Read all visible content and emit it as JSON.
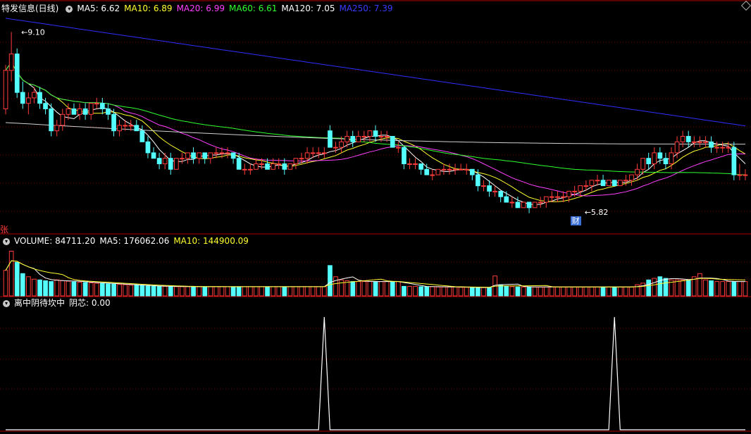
{
  "stock_title": "特发信息(日线)",
  "colors": {
    "up": "#ff3b3b",
    "down": "#54ffff",
    "ma5": "#ffffff",
    "ma10": "#ffff2e",
    "ma20": "#ff40ff",
    "ma60": "#2eff2e",
    "ma120": "#d0d0d0",
    "ma250": "#2e2eff",
    "grid": "#7a0000",
    "divider": "#b00000",
    "signal": "#ffffff"
  },
  "price_legend": [
    {
      "label": "MA5: 6.62",
      "color": "#ffffff"
    },
    {
      "label": "MA10: 6.89",
      "color": "#ffff2e"
    },
    {
      "label": "MA20: 6.99",
      "color": "#ff40ff"
    },
    {
      "label": "MA60: 6.61",
      "color": "#2eff2e"
    },
    {
      "label": "MA120: 7.05",
      "color": "#ffffff"
    },
    {
      "label": "MA250: 7.39",
      "color": "#3a3aff"
    }
  ],
  "volume_legend": [
    {
      "label": "VOLUME: 84711.20",
      "color": "#ffffff"
    },
    {
      "label": "MA5: 176062.06",
      "color": "#ffffff"
    },
    {
      "label": "MA10: 144900.09",
      "color": "#ffff2e"
    }
  ],
  "indicator_legend": [
    {
      "label": "离中阴待坎中",
      "color": "#ffffff"
    },
    {
      "label": "阴芯: 0.00",
      "color": "#ffffff"
    }
  ],
  "side_label": "张",
  "cai_label": "财",
  "chart_data": [
    {
      "type": "candlestick",
      "title": "特发信息(日线)",
      "ylim": [
        5.5,
        9.4
      ],
      "annotations": [
        {
          "text": "9.10",
          "x": 1,
          "value": 9.1
        },
        {
          "text": "5.82",
          "x": 100,
          "value": 5.82
        }
      ],
      "candles": [
        [
          7.7,
          8.5,
          7.6,
          8.4
        ],
        [
          8.4,
          9.1,
          8.2,
          8.7
        ],
        [
          8.7,
          8.8,
          7.9,
          8.0
        ],
        [
          8.0,
          8.2,
          7.7,
          7.8
        ],
        [
          7.8,
          8.0,
          7.6,
          7.9
        ],
        [
          7.9,
          8.1,
          7.8,
          8.0
        ],
        [
          8.0,
          8.1,
          7.7,
          7.8
        ],
        [
          7.8,
          7.9,
          7.6,
          7.7
        ],
        [
          7.7,
          7.8,
          7.2,
          7.3
        ],
        [
          7.3,
          7.5,
          7.2,
          7.4
        ],
        [
          7.4,
          7.7,
          7.3,
          7.6
        ],
        [
          7.6,
          7.8,
          7.5,
          7.7
        ],
        [
          7.7,
          7.8,
          7.6,
          7.6
        ],
        [
          7.6,
          7.8,
          7.5,
          7.7
        ],
        [
          7.7,
          7.8,
          7.5,
          7.6
        ],
        [
          7.6,
          7.8,
          7.5,
          7.8
        ],
        [
          7.8,
          7.9,
          7.7,
          7.8
        ],
        [
          7.8,
          7.9,
          7.6,
          7.7
        ],
        [
          7.7,
          7.8,
          7.5,
          7.6
        ],
        [
          7.6,
          7.7,
          7.2,
          7.3
        ],
        [
          7.3,
          7.5,
          7.2,
          7.4
        ],
        [
          7.4,
          7.5,
          7.3,
          7.4
        ],
        [
          7.4,
          7.5,
          7.3,
          7.4
        ],
        [
          7.4,
          7.5,
          7.3,
          7.3
        ],
        [
          7.3,
          7.4,
          7.1,
          7.1
        ],
        [
          7.1,
          7.2,
          6.8,
          6.9
        ],
        [
          6.9,
          7.0,
          6.8,
          6.8
        ],
        [
          6.8,
          6.9,
          6.6,
          6.7
        ],
        [
          6.7,
          6.9,
          6.6,
          6.8
        ],
        [
          6.8,
          6.9,
          6.5,
          6.6
        ],
        [
          6.6,
          6.8,
          6.6,
          6.8
        ],
        [
          6.8,
          6.9,
          6.7,
          6.8
        ],
        [
          6.8,
          6.9,
          6.7,
          6.9
        ],
        [
          6.9,
          7.0,
          6.7,
          6.8
        ],
        [
          6.8,
          6.9,
          6.7,
          6.9
        ],
        [
          6.9,
          6.9,
          6.7,
          6.8
        ],
        [
          6.8,
          6.9,
          6.7,
          6.9
        ],
        [
          6.9,
          7.0,
          6.8,
          6.9
        ],
        [
          6.9,
          7.0,
          6.8,
          6.9
        ],
        [
          6.9,
          7.0,
          6.8,
          6.9
        ],
        [
          6.9,
          6.9,
          6.7,
          6.8
        ],
        [
          6.8,
          6.9,
          6.6,
          6.6
        ],
        [
          6.6,
          6.7,
          6.5,
          6.6
        ],
        [
          6.6,
          6.7,
          6.5,
          6.6
        ],
        [
          6.6,
          6.8,
          6.6,
          6.7
        ],
        [
          6.7,
          6.8,
          6.6,
          6.7
        ],
        [
          6.7,
          6.8,
          6.6,
          6.6
        ],
        [
          6.6,
          6.8,
          6.6,
          6.7
        ],
        [
          6.7,
          6.8,
          6.6,
          6.7
        ],
        [
          6.7,
          6.8,
          6.5,
          6.6
        ],
        [
          6.6,
          6.7,
          6.6,
          6.7
        ],
        [
          6.7,
          6.8,
          6.6,
          6.8
        ],
        [
          6.8,
          6.9,
          6.7,
          6.8
        ],
        [
          6.8,
          7.0,
          6.7,
          6.9
        ],
        [
          6.9,
          7.0,
          6.8,
          6.9
        ],
        [
          6.9,
          7.0,
          6.8,
          6.9
        ],
        [
          6.9,
          7.0,
          6.8,
          6.9
        ],
        [
          7.3,
          7.4,
          7.0,
          7.0
        ],
        [
          7.0,
          7.1,
          6.9,
          7.0
        ],
        [
          7.0,
          7.2,
          6.9,
          7.1
        ],
        [
          7.1,
          7.3,
          7.0,
          7.2
        ],
        [
          7.2,
          7.3,
          7.0,
          7.1
        ],
        [
          7.1,
          7.3,
          7.1,
          7.2
        ],
        [
          7.2,
          7.3,
          7.1,
          7.2
        ],
        [
          7.2,
          7.3,
          7.1,
          7.3
        ],
        [
          7.3,
          7.4,
          7.1,
          7.2
        ],
        [
          7.2,
          7.3,
          7.1,
          7.2
        ],
        [
          7.2,
          7.3,
          7.1,
          7.2
        ],
        [
          7.2,
          7.2,
          7.0,
          7.0
        ],
        [
          7.0,
          7.1,
          6.9,
          7.0
        ],
        [
          7.0,
          7.0,
          6.6,
          6.7
        ],
        [
          6.7,
          6.8,
          6.6,
          6.7
        ],
        [
          6.7,
          6.8,
          6.6,
          6.7
        ],
        [
          6.7,
          6.7,
          6.5,
          6.6
        ],
        [
          6.6,
          6.7,
          6.5,
          6.5
        ],
        [
          6.5,
          6.6,
          6.4,
          6.5
        ],
        [
          6.5,
          6.6,
          6.5,
          6.6
        ],
        [
          6.6,
          6.7,
          6.5,
          6.6
        ],
        [
          6.6,
          6.7,
          6.5,
          6.6
        ],
        [
          6.6,
          6.7,
          6.5,
          6.6
        ],
        [
          6.6,
          6.7,
          6.6,
          6.6
        ],
        [
          6.6,
          6.7,
          6.5,
          6.6
        ],
        [
          6.6,
          6.6,
          6.4,
          6.5
        ],
        [
          6.5,
          6.6,
          6.2,
          6.3
        ],
        [
          6.3,
          6.4,
          6.2,
          6.3
        ],
        [
          6.3,
          6.4,
          6.1,
          6.2
        ],
        [
          6.2,
          6.3,
          6.1,
          6.2
        ],
        [
          6.2,
          6.2,
          6.0,
          6.1
        ],
        [
          6.1,
          6.2,
          6.0,
          6.0
        ],
        [
          6.0,
          6.1,
          5.9,
          6.0
        ],
        [
          6.0,
          6.1,
          5.9,
          5.9
        ],
        [
          5.9,
          6.0,
          5.9,
          6.0
        ],
        [
          6.0,
          6.0,
          5.8,
          5.9
        ],
        [
          5.9,
          6.0,
          5.9,
          6.0
        ],
        [
          6.0,
          6.1,
          5.9,
          6.0
        ],
        [
          6.0,
          6.1,
          5.9,
          6.1
        ],
        [
          6.1,
          6.2,
          6.0,
          6.1
        ],
        [
          6.1,
          6.2,
          6.0,
          6.1
        ],
        [
          6.1,
          6.2,
          6.0,
          6.1
        ],
        [
          6.1,
          6.2,
          6.0,
          6.2
        ],
        [
          6.2,
          6.3,
          6.1,
          6.2
        ],
        [
          6.2,
          6.3,
          6.1,
          6.3
        ],
        [
          6.3,
          6.4,
          6.2,
          6.3
        ],
        [
          6.3,
          6.4,
          6.2,
          6.4
        ],
        [
          6.4,
          6.5,
          6.3,
          6.4
        ],
        [
          6.4,
          6.5,
          6.3,
          6.3
        ],
        [
          6.3,
          6.4,
          6.3,
          6.4
        ],
        [
          6.4,
          6.4,
          6.3,
          6.3
        ],
        [
          6.3,
          6.4,
          6.3,
          6.4
        ],
        [
          6.4,
          6.5,
          6.3,
          6.4
        ],
        [
          6.4,
          6.5,
          6.3,
          6.5
        ],
        [
          6.5,
          6.7,
          6.4,
          6.6
        ],
        [
          6.6,
          6.8,
          6.5,
          6.8
        ],
        [
          6.8,
          6.9,
          6.6,
          6.7
        ],
        [
          6.7,
          7.0,
          6.6,
          6.9
        ],
        [
          6.9,
          7.0,
          6.7,
          6.8
        ],
        [
          6.8,
          6.9,
          6.6,
          6.7
        ],
        [
          6.7,
          7.0,
          6.6,
          6.9
        ],
        [
          6.9,
          7.2,
          6.8,
          7.1
        ],
        [
          7.1,
          7.3,
          7.0,
          7.2
        ],
        [
          7.2,
          7.3,
          7.0,
          7.1
        ],
        [
          7.1,
          7.2,
          7.0,
          7.1
        ],
        [
          7.1,
          7.2,
          7.0,
          7.1
        ],
        [
          7.1,
          7.2,
          7.0,
          7.1
        ],
        [
          7.1,
          7.2,
          6.9,
          7.0
        ],
        [
          7.0,
          7.1,
          6.9,
          7.0
        ],
        [
          7.0,
          7.1,
          6.9,
          7.0
        ],
        [
          7.0,
          7.1,
          6.9,
          7.0
        ],
        [
          7.0,
          7.1,
          6.4,
          6.5
        ],
        [
          6.5,
          6.7,
          6.4,
          6.5
        ],
        [
          6.5,
          6.6,
          6.4,
          6.5
        ]
      ]
    },
    {
      "type": "bar",
      "title": "VOLUME",
      "ylim": [
        0,
        300000
      ],
      "values": [
        160000,
        280000,
        210000,
        140000,
        120000,
        105000,
        100000,
        95000,
        90000,
        100000,
        95000,
        92000,
        88000,
        86000,
        84000,
        82000,
        80000,
        78000,
        76000,
        74000,
        72000,
        70000,
        68000,
        66000,
        64000,
        62000,
        60000,
        60000,
        60000,
        60000,
        58000,
        58000,
        58000,
        58000,
        58000,
        58000,
        58000,
        58000,
        58000,
        58000,
        58000,
        58000,
        58000,
        58000,
        58000,
        58000,
        58000,
        58000,
        58000,
        58000,
        58000,
        58000,
        58000,
        58000,
        58000,
        58000,
        58000,
        190000,
        120000,
        100000,
        95000,
        90000,
        90000,
        90000,
        90000,
        90000,
        90000,
        90000,
        90000,
        90000,
        60000,
        60000,
        60000,
        58000,
        58000,
        58000,
        56000,
        56000,
        56000,
        56000,
        54000,
        54000,
        52000,
        52000,
        52000,
        52000,
        125000,
        70000,
        60000,
        58000,
        56000,
        56000,
        56000,
        56000,
        56000,
        56000,
        56000,
        56000,
        56000,
        56000,
        56000,
        56000,
        56000,
        56000,
        56000,
        56000,
        56000,
        56000,
        56000,
        56000,
        56000,
        70000,
        80000,
        100000,
        110000,
        120000,
        110000,
        100000,
        100000,
        100000,
        100000,
        120000,
        140000,
        100000,
        95000,
        90000,
        90000,
        90000,
        90000,
        90000,
        90000,
        145000,
        110000,
        84711
      ]
    },
    {
      "type": "line",
      "title": "离中阴待坎中",
      "ylim": [
        0,
        1
      ],
      "x": [
        0,
        55,
        56,
        57,
        106,
        107,
        108,
        130
      ],
      "values": [
        0,
        0,
        1,
        0,
        0,
        1,
        0,
        0
      ]
    }
  ]
}
